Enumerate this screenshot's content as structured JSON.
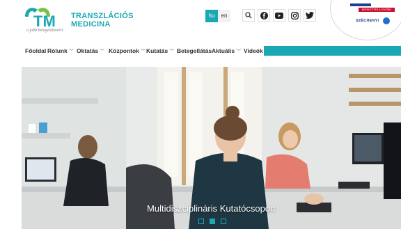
{
  "logo": {
    "mark": "TM",
    "line1": "TRANSZLÁCIÓS",
    "line2": "MEDICINA",
    "tagline": "a jobb betegellátásért"
  },
  "languages": [
    {
      "code": "hu",
      "active": true
    },
    {
      "code": "en",
      "active": false
    }
  ],
  "header_icons": [
    "search-icon",
    "facebook-icon",
    "youtube-icon",
    "instagram-icon",
    "twitter-icon"
  ],
  "badge": {
    "red_text": "BEFEKTETÉS A JÖVŐBE",
    "label": "SZÉCHENYI"
  },
  "nav": {
    "items": [
      {
        "label": "Főoldal",
        "dropdown": false
      },
      {
        "label": "Rólunk",
        "dropdown": true
      },
      {
        "label": "Oktatás",
        "dropdown": true
      },
      {
        "label": "Központok",
        "dropdown": true
      },
      {
        "label": "Kutatás",
        "dropdown": true
      },
      {
        "label": "Betegellátás",
        "dropdown": false
      },
      {
        "label": "Aktuális",
        "dropdown": true
      },
      {
        "label": "Videók",
        "dropdown": false
      }
    ]
  },
  "hero": {
    "caption": "Multidiszciplináris Kutatócsoport",
    "slides": 3,
    "active_slide": 2
  },
  "colors": {
    "accent": "#1aa8b5",
    "badge_blue": "#1d3f8f",
    "badge_red": "#c8102e"
  }
}
